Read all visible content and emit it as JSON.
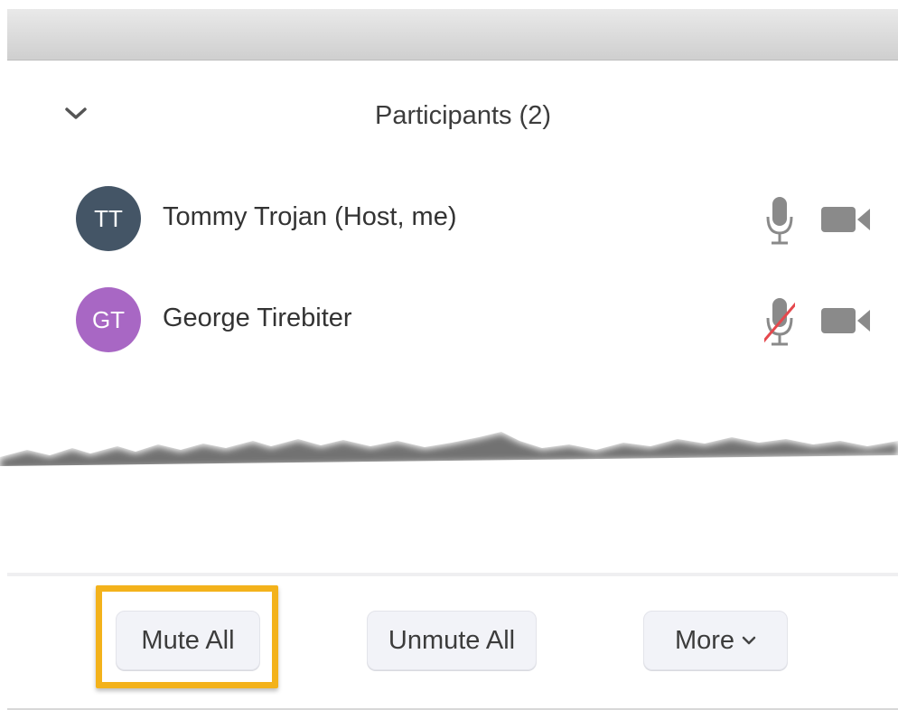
{
  "panel": {
    "title": "Participants (2)"
  },
  "participants": [
    {
      "initials": "TT",
      "name": "Tommy Trojan (Host, me)",
      "avatar_color": "#445566",
      "mic": "on",
      "video": "on"
    },
    {
      "initials": "GT",
      "name": "George Tirebiter",
      "avatar_color": "#a867c4",
      "mic": "muted",
      "video": "on"
    }
  ],
  "footer": {
    "mute_all_label": "Mute All",
    "unmute_all_label": "Unmute All",
    "more_label": "More"
  },
  "colors": {
    "highlight": "#f3b21b",
    "muted_slash": "#e5484d",
    "icon_gray": "#8a8a8a"
  },
  "icons": [
    "chevron-down-icon",
    "microphone-icon",
    "microphone-muted-icon",
    "video-camera-icon"
  ]
}
